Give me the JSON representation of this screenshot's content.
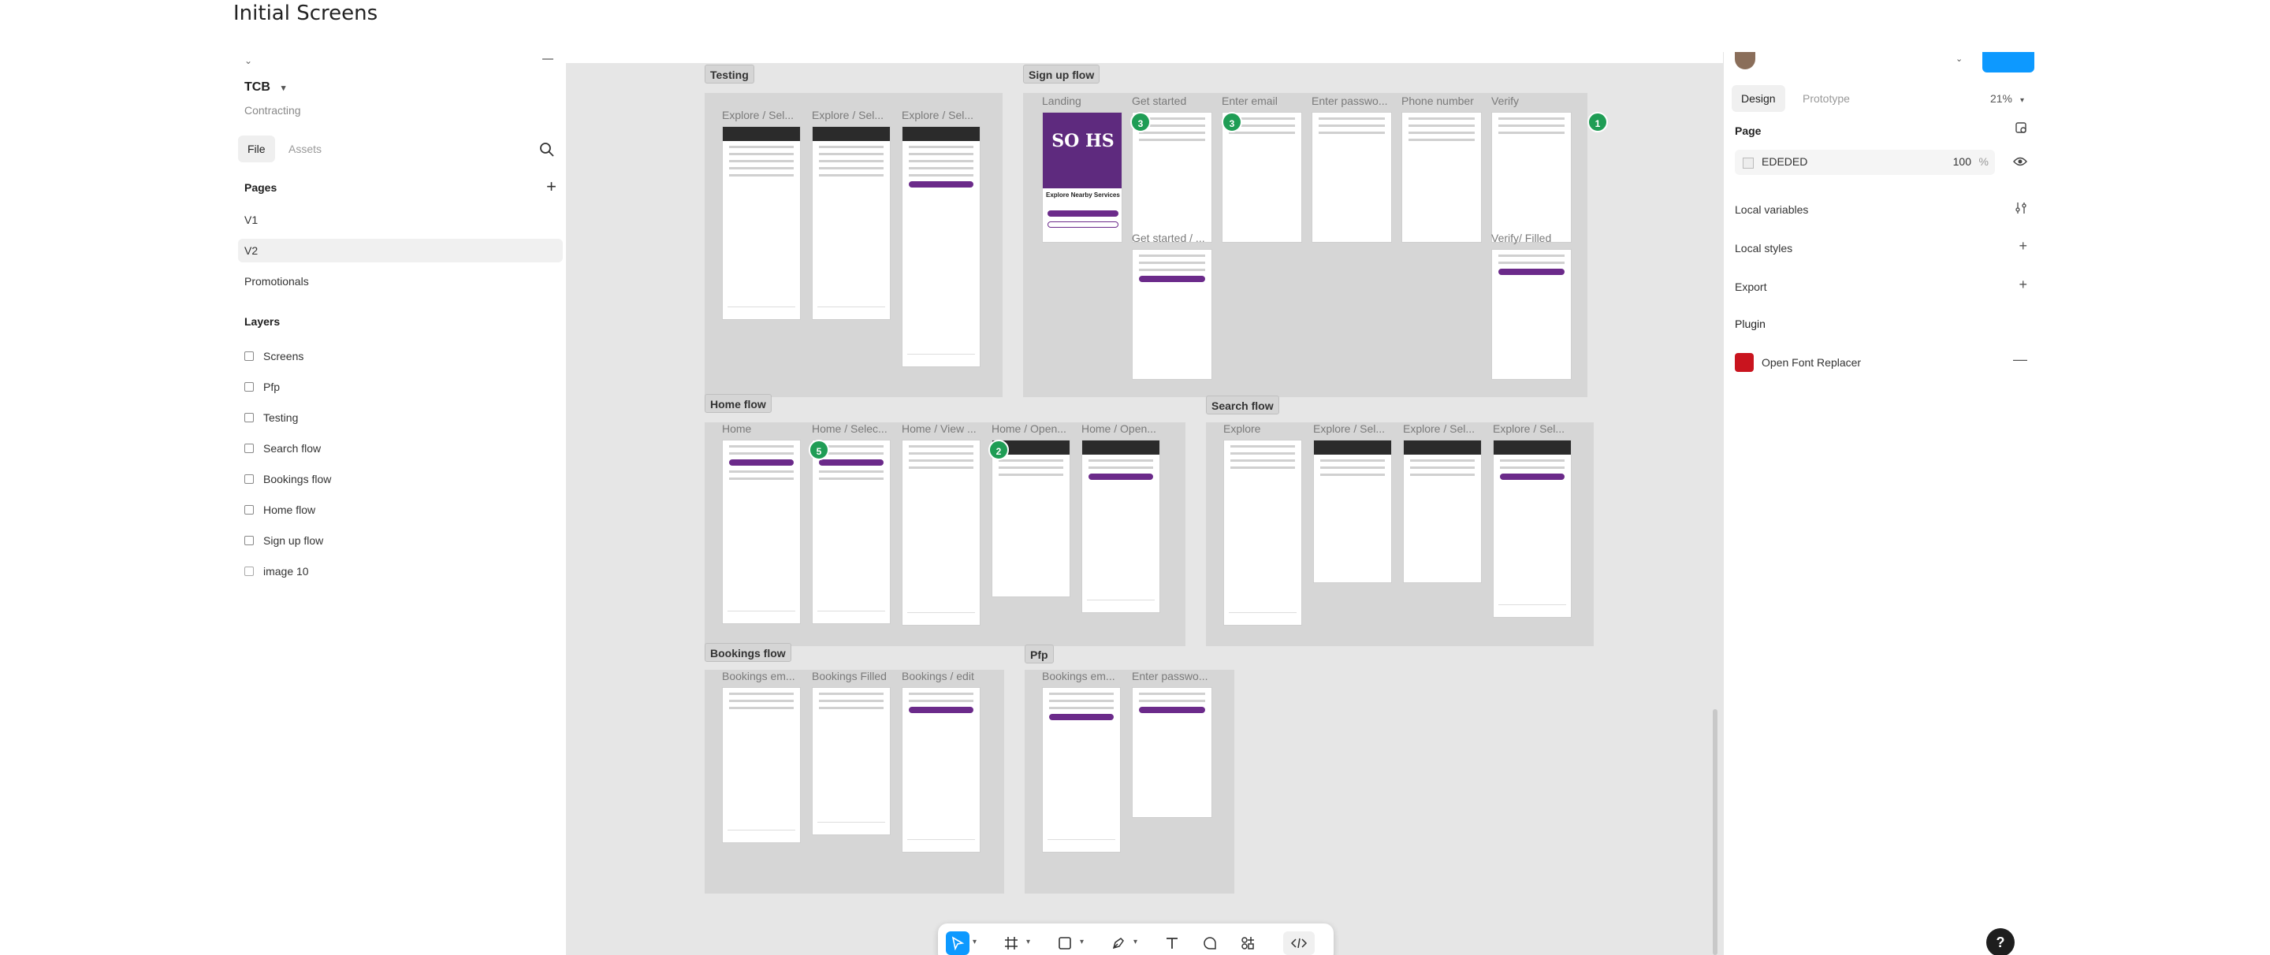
{
  "title": "Initial Screens",
  "project": {
    "name": "TCB",
    "team": "Contracting"
  },
  "left_tabs": {
    "file": "File",
    "assets": "Assets"
  },
  "pages": {
    "heading": "Pages",
    "items": [
      "V1",
      "V2",
      "Promotionals"
    ],
    "selected": "V2"
  },
  "layers": {
    "heading": "Layers",
    "items": [
      "Screens",
      "Pfp",
      "Testing",
      "Search flow",
      "Bookings flow",
      "Home flow",
      "Sign up flow",
      "image 10"
    ]
  },
  "canvas": {
    "sections": {
      "testing": {
        "label": "Testing",
        "frames": [
          "Explore / Sel...",
          "Explore / Sel...",
          "Explore / Sel..."
        ]
      },
      "signup": {
        "label": "Sign up flow",
        "frames": [
          "Landing",
          "Get started",
          "Enter email",
          "Enter passwo...",
          "Phone number",
          "Verify",
          "Get started / ...",
          "Verify/ Filled"
        ],
        "brand": "SO HS",
        "brand_caption": "Explore Nearby Services"
      },
      "home": {
        "label": "Home flow",
        "frames": [
          "Home",
          "Home / Selec...",
          "Home / View ...",
          "Home / Open...",
          "Home / Open..."
        ]
      },
      "search": {
        "label": "Search flow",
        "frames": [
          "Explore",
          "Explore / Sel...",
          "Explore / Sel...",
          "Explore / Sel..."
        ]
      },
      "bookings": {
        "label": "Bookings flow",
        "frames": [
          "Bookings em...",
          "Bookings Filled",
          "Bookings / edit"
        ]
      },
      "pfp": {
        "label": "Pfp",
        "frames": [
          "Bookings em...",
          "Enter passwo..."
        ]
      }
    },
    "badges": {
      "b1": "3",
      "b2": "3",
      "b3": "1",
      "b4": "5",
      "b5": "2"
    }
  },
  "toolbar": {
    "tools": [
      "move-tool",
      "frame-tool",
      "shape-tool",
      "pen-tool",
      "text-tool",
      "comment-tool",
      "actions-tool",
      "dev-mode"
    ]
  },
  "right_panel": {
    "tabs": {
      "design": "Design",
      "prototype": "Prototype"
    },
    "zoom": "21%",
    "page_heading": "Page",
    "fill_hex": "EDEDED",
    "fill_opacity": "100",
    "fill_unit": "%",
    "local_variables": "Local variables",
    "local_styles": "Local styles",
    "export": "Export",
    "plugin_heading": "Plugin",
    "plugin_name": "Open Font Replacer"
  },
  "colors": {
    "accent": "#0d99ff",
    "brand_purple": "#5e2a7e",
    "badge_green": "#1f9d55",
    "canvas_bg": "#e6e6e6",
    "plugin_red": "#c9141e"
  },
  "help": "?"
}
